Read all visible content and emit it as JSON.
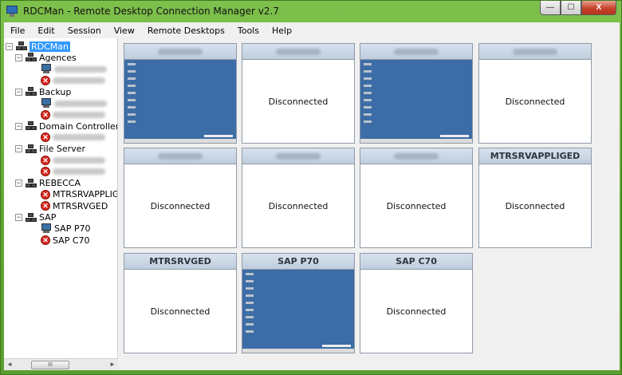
{
  "window": {
    "title": "RDCMan - Remote Desktop Connection Manager v2.7"
  },
  "menu": [
    "File",
    "Edit",
    "Session",
    "View",
    "Remote Desktops",
    "Tools",
    "Help"
  ],
  "tree": {
    "root": "RDCMan",
    "groups": [
      {
        "name": "Agences",
        "servers": [
          {
            "name": "",
            "status": "connected"
          },
          {
            "name": "",
            "status": "disconnected"
          }
        ]
      },
      {
        "name": "Backup",
        "servers": [
          {
            "name": "",
            "status": "connected"
          },
          {
            "name": "",
            "status": "disconnected"
          }
        ]
      },
      {
        "name": "Domain Controller",
        "servers": [
          {
            "name": "",
            "status": "disconnected"
          }
        ]
      },
      {
        "name": "File Server",
        "servers": [
          {
            "name": "",
            "status": "disconnected"
          },
          {
            "name": "",
            "status": "disconnected"
          }
        ]
      },
      {
        "name": "REBECCA",
        "servers": [
          {
            "name": "MTRSRVAPPLIGE",
            "status": "disconnected"
          },
          {
            "name": "MTRSRVGED",
            "status": "disconnected"
          }
        ]
      },
      {
        "name": "SAP",
        "servers": [
          {
            "name": "SAP P70",
            "status": "connected"
          },
          {
            "name": "SAP C70",
            "status": "disconnected"
          }
        ]
      }
    ]
  },
  "scrollbar": {
    "thumb_label": "III",
    "left_arrow": "◄",
    "right_arrow": "►"
  },
  "tiles": [
    {
      "title": "",
      "status": "connected",
      "text": ""
    },
    {
      "title": "",
      "status": "disconnected",
      "text": "Disconnected"
    },
    {
      "title": "",
      "status": "connected",
      "text": ""
    },
    {
      "title": "",
      "status": "disconnected",
      "text": "Disconnected"
    },
    {
      "title": "",
      "status": "disconnected",
      "text": "Disconnected"
    },
    {
      "title": "",
      "status": "disconnected",
      "text": "Disconnected"
    },
    {
      "title": "",
      "status": "disconnected",
      "text": "Disconnected"
    },
    {
      "title": "MTRSRVAPPLIGED",
      "status": "disconnected",
      "text": "Disconnected"
    },
    {
      "title": "MTRSRVGED",
      "status": "disconnected",
      "text": "Disconnected"
    },
    {
      "title": "SAP P70",
      "status": "connected",
      "text": ""
    },
    {
      "title": "SAP C70",
      "status": "disconnected",
      "text": "Disconnected"
    }
  ],
  "window_controls": {
    "minimize": "—",
    "maximize": "☐",
    "close": "X"
  }
}
